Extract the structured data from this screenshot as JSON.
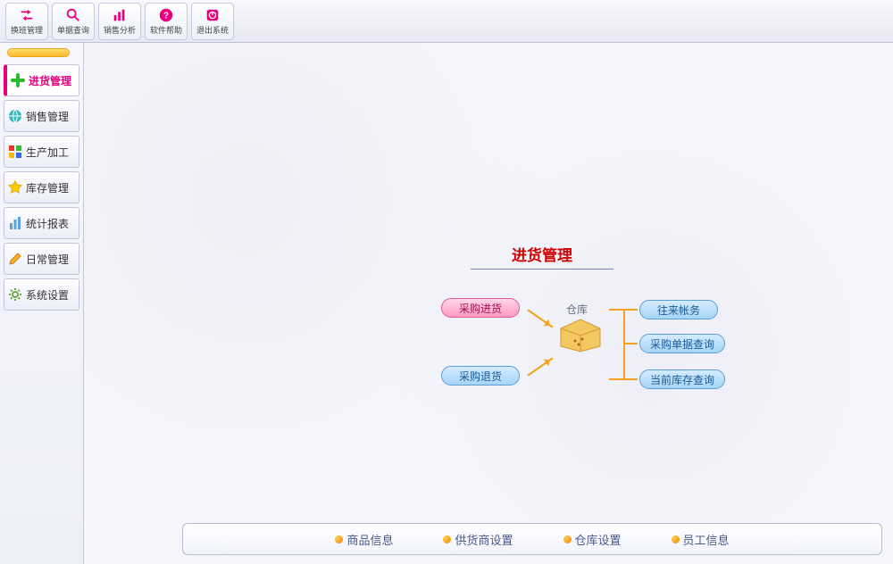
{
  "toolbar": [
    {
      "name": "shift-mgmt",
      "label": "换班管理",
      "icon": "swap"
    },
    {
      "name": "order-query",
      "label": "单据查询",
      "icon": "search"
    },
    {
      "name": "sales-analysis",
      "label": "销售分析",
      "icon": "bars"
    },
    {
      "name": "software-help",
      "label": "软件帮助",
      "icon": "help"
    },
    {
      "name": "exit-system",
      "label": "退出系统",
      "icon": "power"
    }
  ],
  "sidebar": [
    {
      "name": "purchase-mgmt",
      "label": "进货管理",
      "icon": "plus",
      "active": true
    },
    {
      "name": "sales-mgmt",
      "label": "销售管理",
      "icon": "globe"
    },
    {
      "name": "production",
      "label": "生产加工",
      "icon": "blocks"
    },
    {
      "name": "inventory-mgmt",
      "label": "库存管理",
      "icon": "star"
    },
    {
      "name": "stat-reports",
      "label": "统计报表",
      "icon": "chart"
    },
    {
      "name": "daily-mgmt",
      "label": "日常管理",
      "icon": "pencil"
    },
    {
      "name": "system-settings",
      "label": "系统设置",
      "icon": "gear"
    }
  ],
  "diagram": {
    "title": "进货管理",
    "center_label": "仓库",
    "left": [
      {
        "name": "purchase-in",
        "label": "采购进货",
        "style": "pink"
      },
      {
        "name": "purchase-return",
        "label": "采购退货",
        "style": "blue"
      }
    ],
    "right": [
      {
        "name": "account-flow",
        "label": "往来帐务",
        "style": "blue"
      },
      {
        "name": "po-query",
        "label": "采购单据查询",
        "style": "blue"
      },
      {
        "name": "stock-query",
        "label": "当前库存查询",
        "style": "blue"
      }
    ]
  },
  "footer": [
    {
      "name": "product-info",
      "label": "商品信息"
    },
    {
      "name": "supplier-setup",
      "label": "供货商设置"
    },
    {
      "name": "warehouse-setup",
      "label": "仓库设置"
    },
    {
      "name": "staff-info",
      "label": "员工信息"
    }
  ]
}
